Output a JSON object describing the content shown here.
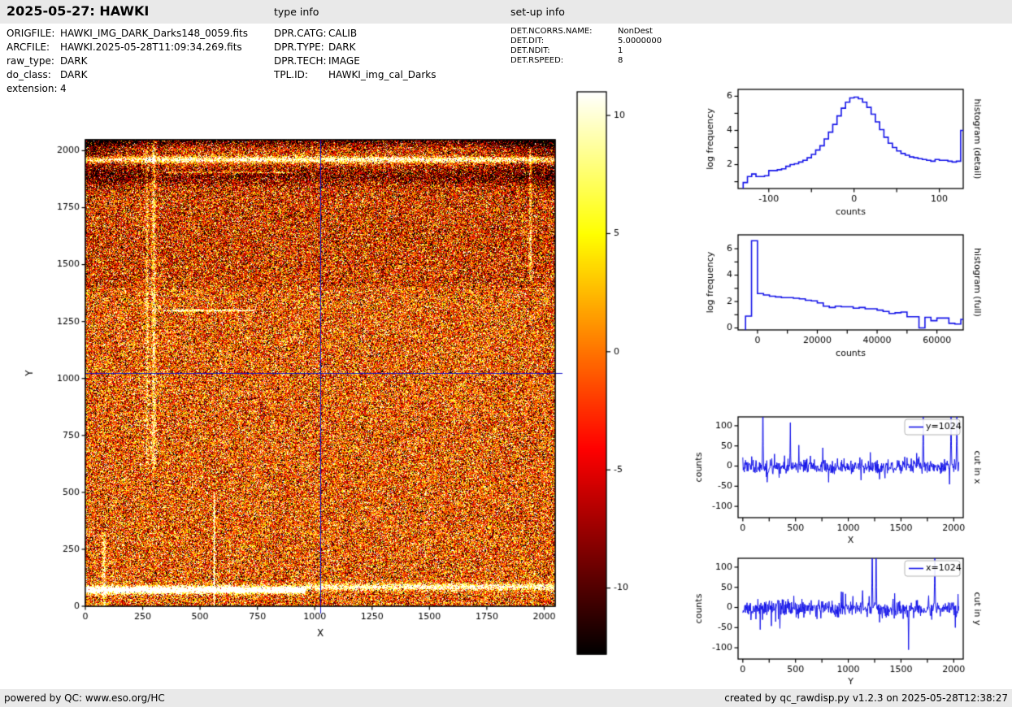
{
  "header": {
    "title": "2025-05-27: HAWKI",
    "type_info_label": "type info",
    "setup_info_label": "set-up info"
  },
  "file_info": {
    "rows": [
      {
        "label": "ORIGFILE:",
        "value": "HAWKI_IMG_DARK_Darks148_0059.fits"
      },
      {
        "label": "ARCFILE:",
        "value": "HAWKI.2025-05-28T11:09:34.269.fits"
      },
      {
        "label": "raw_type:",
        "value": "DARK"
      },
      {
        "label": "do_class:",
        "value": "DARK"
      },
      {
        "label": "extension:",
        "value": "4"
      }
    ]
  },
  "type_info": {
    "rows": [
      {
        "label": "DPR.CATG:",
        "value": "CALIB"
      },
      {
        "label": "DPR.TYPE:",
        "value": "DARK"
      },
      {
        "label": "DPR.TECH:",
        "value": "IMAGE"
      },
      {
        "label": "TPL.ID:",
        "value": "HAWKI_img_cal_Darks"
      }
    ]
  },
  "setup_info": {
    "rows": [
      {
        "label": "DET.NCORRS.NAME:",
        "value": "NonDest"
      },
      {
        "label": "DET.DIT:",
        "value": "5.0000000"
      },
      {
        "label": "DET.NDIT:",
        "value": "1"
      },
      {
        "label": "DET.RSPEED:",
        "value": "8"
      }
    ]
  },
  "footer": {
    "left": "powered by QC: www.eso.org/HC",
    "right": "created by qc_rawdisp.py v1.2.3 on 2025-05-28T12:38:27"
  },
  "colors": {
    "plot_line": "#1414e8",
    "crosshair": "#1515cc",
    "band_bg": "#e9e9e9",
    "legend_border": "#b3b3b3"
  },
  "chart_data": [
    {
      "id": "main_image",
      "type": "heatmap",
      "xlabel": "X",
      "ylabel": "Y",
      "xlim": [
        0,
        2048
      ],
      "ylim": [
        0,
        2048
      ],
      "xticks": [
        {
          "v": 0,
          "l": "0"
        },
        {
          "v": 250,
          "l": "250"
        },
        {
          "v": 500,
          "l": "500"
        },
        {
          "v": 750,
          "l": "750"
        },
        {
          "v": 1000,
          "l": "1000"
        },
        {
          "v": 1250,
          "l": "1250"
        },
        {
          "v": 1500,
          "l": "1500"
        },
        {
          "v": 1750,
          "l": "1750"
        },
        {
          "v": 2000,
          "l": "2000"
        }
      ],
      "yticks": [
        {
          "v": 0,
          "l": "0"
        },
        {
          "v": 250,
          "l": "250"
        },
        {
          "v": 500,
          "l": "500"
        },
        {
          "v": 750,
          "l": "750"
        },
        {
          "v": 1000,
          "l": "1000"
        },
        {
          "v": 1250,
          "l": "1250"
        },
        {
          "v": 1500,
          "l": "1500"
        },
        {
          "v": 1750,
          "l": "1750"
        },
        {
          "v": 2000,
          "l": "2000"
        }
      ],
      "colormap": "hot",
      "vmin": -12.8,
      "vmax": 11,
      "crosshair": {
        "x": 1024,
        "y": 1024
      },
      "noise": {
        "mean": -1.2,
        "sigma": 6.5,
        "outlier_frac": 0.12,
        "outlier_sigma": 16
      },
      "features": [
        {
          "type": "hband",
          "y": 74,
          "sigma": 16,
          "amp": 25,
          "xmax": 960
        },
        {
          "type": "hband",
          "y": 86,
          "sigma": 14,
          "amp": 14,
          "xmin": 960
        },
        {
          "type": "hband",
          "y": 1962,
          "sigma": 14,
          "amp": 15
        },
        {
          "type": "hband",
          "y": 1888,
          "sigma": 38,
          "amp": -5
        },
        {
          "type": "hline",
          "y": 1906,
          "sigma": 4,
          "amp": 9,
          "xmin": 350,
          "xmax": 900
        },
        {
          "type": "hline",
          "y": 1300,
          "sigma": 5,
          "amp": 13,
          "xmin": 340,
          "xmax": 735
        },
        {
          "type": "vline",
          "x": 268,
          "sigma": 6,
          "amp": 7,
          "ymin": 620
        },
        {
          "type": "vline",
          "x": 297,
          "sigma": 8,
          "amp": 9,
          "ymin": 600
        },
        {
          "type": "vline",
          "x": 560,
          "sigma": 3,
          "amp": 22,
          "ymax": 500
        },
        {
          "type": "vline",
          "x": 1938,
          "sigma": 6,
          "amp": 9,
          "ymin": 1430,
          "ymax": 2010
        },
        {
          "type": "vline",
          "x": 80,
          "sigma": 8,
          "amp": 8,
          "ymax": 330
        },
        {
          "type": "gradtop",
          "ymin": 2012,
          "amp": -9
        },
        {
          "type": "topcorners",
          "ymin": 1790,
          "extent": 380,
          "amp": -8
        },
        {
          "type": "shade",
          "ymin": 1400,
          "amp": -2
        }
      ]
    },
    {
      "id": "colorbar",
      "type": "colorbar",
      "colormap": "hot",
      "vmin": -12.8,
      "vmax": 11,
      "ticks": [
        {
          "v": 10,
          "l": "10"
        },
        {
          "v": 5,
          "l": "5"
        },
        {
          "v": 0,
          "l": "0"
        },
        {
          "v": -5,
          "l": "-5"
        },
        {
          "v": -10,
          "l": "-10"
        }
      ]
    },
    {
      "id": "hist_detail",
      "type": "histogram",
      "xlabel": "counts",
      "ylabel": "log frequency",
      "right_label": "histogram (detail)",
      "xlim": [
        -136,
        128
      ],
      "ylim": [
        0.6,
        6.4
      ],
      "xticks": [
        {
          "v": -100,
          "l": "-100"
        },
        {
          "v": -50
        },
        {
          "v": 0,
          "l": "0"
        },
        {
          "v": 50
        },
        {
          "v": 100,
          "l": "100"
        }
      ],
      "yticks": [
        {
          "v": 1
        },
        {
          "v": 2,
          "l": "2"
        },
        {
          "v": 3
        },
        {
          "v": 4,
          "l": "4"
        },
        {
          "v": 5
        },
        {
          "v": 6,
          "l": "6"
        }
      ],
      "bin_start": -130,
      "bin_width": 5,
      "values": [
        0.95,
        1.3,
        1.45,
        1.3,
        1.3,
        1.35,
        1.65,
        1.65,
        1.7,
        1.75,
        1.9,
        2.0,
        2.05,
        2.15,
        2.25,
        2.4,
        2.6,
        2.85,
        3.1,
        3.5,
        3.9,
        4.35,
        4.85,
        5.3,
        5.65,
        5.9,
        5.95,
        5.85,
        5.65,
        5.35,
        4.95,
        4.5,
        4.05,
        3.6,
        3.25,
        3.0,
        2.8,
        2.65,
        2.55,
        2.45,
        2.4,
        2.35,
        2.3,
        2.25,
        2.2,
        2.3,
        2.25,
        2.25,
        2.2,
        2.15,
        2.2,
        4.0
      ]
    },
    {
      "id": "hist_full",
      "type": "histogram",
      "xlabel": "counts",
      "ylabel": "log frequency",
      "right_label": "histogram (full)",
      "xlim": [
        -6500,
        68800
      ],
      "ylim": [
        -0.15,
        7.05
      ],
      "xticks": [
        {
          "v": 0,
          "l": "0"
        },
        {
          "v": 10000
        },
        {
          "v": 20000,
          "l": "20000"
        },
        {
          "v": 30000
        },
        {
          "v": 40000,
          "l": "40000"
        },
        {
          "v": 50000
        },
        {
          "v": 60000,
          "l": "60000"
        }
      ],
      "yticks": [
        {
          "v": 0,
          "l": "0"
        },
        {
          "v": 1
        },
        {
          "v": 2,
          "l": "2"
        },
        {
          "v": 3
        },
        {
          "v": 4,
          "l": "4"
        },
        {
          "v": 5
        },
        {
          "v": 6,
          "l": "6"
        }
      ],
      "bin_start": -4000,
      "bin_width": 2000,
      "values": [
        0.9,
        6.6,
        2.6,
        2.5,
        2.4,
        2.35,
        2.3,
        2.3,
        2.25,
        2.2,
        2.1,
        2.05,
        1.9,
        1.65,
        1.55,
        1.65,
        1.6,
        1.6,
        1.5,
        1.55,
        1.45,
        1.45,
        1.35,
        1.25,
        1.1,
        1.15,
        1.2,
        0.85,
        0.85,
        0.0,
        0.8,
        0.55,
        0.75,
        0.75,
        0.35,
        0.3,
        0.65
      ]
    },
    {
      "id": "cut_x",
      "type": "cut",
      "xlabel": "X",
      "ylabel": "counts",
      "right_label": "cut in x",
      "legend": {
        "label": "y=1024"
      },
      "xlim": [
        -45,
        2090
      ],
      "ylim": [
        -128,
        122
      ],
      "xticks": [
        {
          "v": 0,
          "l": "0"
        },
        {
          "v": 250
        },
        {
          "v": 500,
          "l": "500"
        },
        {
          "v": 750
        },
        {
          "v": 1000,
          "l": "1000"
        },
        {
          "v": 1250
        },
        {
          "v": 1500,
          "l": "1500"
        },
        {
          "v": 1750
        },
        {
          "v": 2000,
          "l": "2000"
        }
      ],
      "yticks": [
        {
          "v": -100,
          "l": "-100"
        },
        {
          "v": -50,
          "l": "-50"
        },
        {
          "v": 0,
          "l": "0"
        },
        {
          "v": 50,
          "l": "50"
        },
        {
          "v": 100,
          "l": "100"
        }
      ],
      "n": 560,
      "noise_mean": -2,
      "noise_sigma": 8.5,
      "spikes": [
        {
          "x": 190,
          "v": 200
        },
        {
          "x": 450,
          "v": 108
        },
        {
          "x": 532,
          "v": 52
        },
        {
          "x": 300,
          "v": 30
        },
        {
          "x": 1210,
          "v": 34
        },
        {
          "x": 1650,
          "v": 32
        },
        {
          "x": 1710,
          "v": 200
        },
        {
          "x": 1975,
          "v": 200
        },
        {
          "x": 2030,
          "v": 200
        },
        {
          "x": 230,
          "v": -40
        },
        {
          "x": 1120,
          "v": -35
        },
        {
          "x": 1350,
          "v": -30
        }
      ]
    },
    {
      "id": "cut_y",
      "type": "cut",
      "xlabel": "Y",
      "ylabel": "counts",
      "right_label": "cut in y",
      "legend": {
        "label": "x=1024"
      },
      "xlim": [
        -45,
        2090
      ],
      "ylim": [
        -128,
        122
      ],
      "xticks": [
        {
          "v": 0,
          "l": "0"
        },
        {
          "v": 250
        },
        {
          "v": 500,
          "l": "500"
        },
        {
          "v": 750
        },
        {
          "v": 1000,
          "l": "1000"
        },
        {
          "v": 1250
        },
        {
          "v": 1500,
          "l": "1500"
        },
        {
          "v": 1750
        },
        {
          "v": 2000,
          "l": "2000"
        }
      ],
      "yticks": [
        {
          "v": -100,
          "l": "-100"
        },
        {
          "v": -50,
          "l": "-50"
        },
        {
          "v": 0,
          "l": "0"
        },
        {
          "v": 50,
          "l": "50"
        },
        {
          "v": 100,
          "l": "100"
        }
      ],
      "n": 560,
      "noise_mean": -2,
      "noise_sigma": 10,
      "spikes": [
        {
          "x": 165,
          "v": -55
        },
        {
          "x": 270,
          "v": -46
        },
        {
          "x": 350,
          "v": -52
        },
        {
          "x": 950,
          "v": 38
        },
        {
          "x": 1135,
          "v": 42
        },
        {
          "x": 1228,
          "v": 200
        },
        {
          "x": 1265,
          "v": 200
        },
        {
          "x": 1440,
          "v": 35
        },
        {
          "x": 1570,
          "v": -105
        },
        {
          "x": 1820,
          "v": 200
        },
        {
          "x": 2015,
          "v": -50
        },
        {
          "x": 2040,
          "v": 33
        }
      ]
    }
  ]
}
